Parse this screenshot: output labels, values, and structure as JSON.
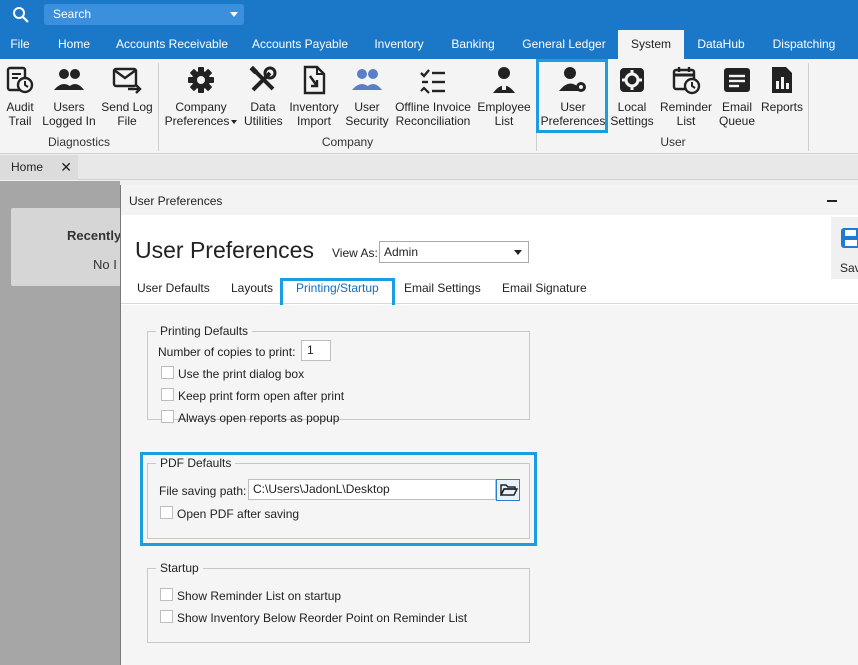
{
  "search": {
    "label": "Search"
  },
  "menu": [
    "File",
    "Home",
    "Accounts Receivable",
    "Accounts Payable",
    "Inventory",
    "Banking",
    "General Ledger",
    "System",
    "DataHub",
    "Dispatching"
  ],
  "ribbon": {
    "diagnostics": {
      "label": "Diagnostics",
      "buttons": [
        [
          "Audit",
          "Trail"
        ],
        [
          "Users",
          "Logged In"
        ],
        [
          "Send Log",
          "File"
        ]
      ]
    },
    "company": {
      "label": "Company",
      "buttons": [
        [
          "Company",
          "Preferences"
        ],
        [
          "Data",
          "Utilities"
        ],
        [
          "Inventory",
          "Import"
        ],
        [
          "User",
          "Security"
        ],
        [
          "Offline Invoice",
          "Reconciliation"
        ],
        [
          "Employee",
          "List"
        ]
      ]
    },
    "user": {
      "label": "User",
      "buttons": [
        [
          "User",
          "Preferences"
        ],
        [
          "Local",
          "Settings"
        ],
        [
          "Reminder",
          "List"
        ],
        [
          "Email",
          "Queue"
        ],
        [
          "Reports",
          ""
        ]
      ]
    }
  },
  "doc_tab": {
    "label": "Home",
    "close": "✕"
  },
  "recent": {
    "title": "Recently",
    "empty": "No I"
  },
  "window": {
    "title": "User Preferences",
    "page_title": "User Preferences",
    "view_as_label": "View As:",
    "view_as_value": "Admin",
    "save_label": "Sav",
    "tabs": [
      "User Defaults",
      "Layouts",
      "Printing/Startup",
      "Email Settings",
      "Email Signature"
    ],
    "active_tab": "Printing/Startup"
  },
  "printing": {
    "title": "Printing Defaults",
    "copies_label": "Number of copies to print:",
    "copies_value": "1",
    "options": [
      "Use the print dialog box",
      "Keep print form open after print",
      "Always open reports as popup"
    ]
  },
  "pdf": {
    "title": "PDF Defaults",
    "path_label": "File saving path:",
    "path_value": "C:\\Users\\JadonL\\Desktop",
    "open_after_label": "Open PDF after saving"
  },
  "startup": {
    "title": "Startup",
    "options": [
      "Show Reminder List on startup",
      "Show Inventory Below Reorder Point on Reminder List"
    ]
  },
  "colors": {
    "brand": "#1b78c8",
    "highlight": "#1a9ee0",
    "active_tab_text": "#0f6fc4"
  }
}
